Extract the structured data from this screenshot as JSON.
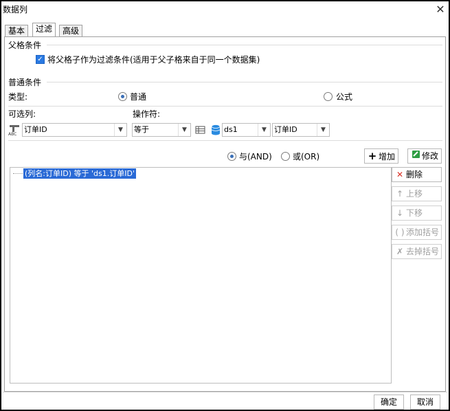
{
  "window": {
    "title": "数据列",
    "close_glyph": "✕"
  },
  "tabs": [
    {
      "label": "基本"
    },
    {
      "label": "过滤"
    },
    {
      "label": "高级"
    }
  ],
  "parent_condition": {
    "section_label": "父格条件",
    "checkbox_label": "将父格子作为过滤条件(适用于父子格来自于同一个数据集)",
    "checked": true
  },
  "normal_condition": {
    "section_label": "普通条件",
    "type_label": "类型:",
    "type_options": [
      {
        "label": "普通",
        "selected": true
      },
      {
        "label": "公式",
        "selected": false
      }
    ],
    "column_label": "可选列:",
    "operator_label": "操作符:",
    "column_value": "订单ID",
    "operator_value": "等于",
    "dataset_value": "ds1",
    "target_column_value": "订单ID"
  },
  "logic": {
    "options": [
      {
        "label": "与(AND)",
        "selected": true
      },
      {
        "label": "或(OR)",
        "selected": false
      }
    ],
    "add_button": "增加",
    "modify_button": "修改"
  },
  "condition_list": {
    "items": [
      "(列名:订单ID) 等于 'ds1.订单ID'"
    ]
  },
  "side_buttons": {
    "delete": "删除",
    "move_up": "上移",
    "move_down": "下移",
    "add_bracket": "添加括号",
    "remove_bracket": "去掉括号"
  },
  "footer": {
    "ok": "确定",
    "cancel": "取消"
  },
  "colors": {
    "accent": "#2a6ad6",
    "delete_icon": "#d93025",
    "modify_icon": "#2f9e44"
  }
}
